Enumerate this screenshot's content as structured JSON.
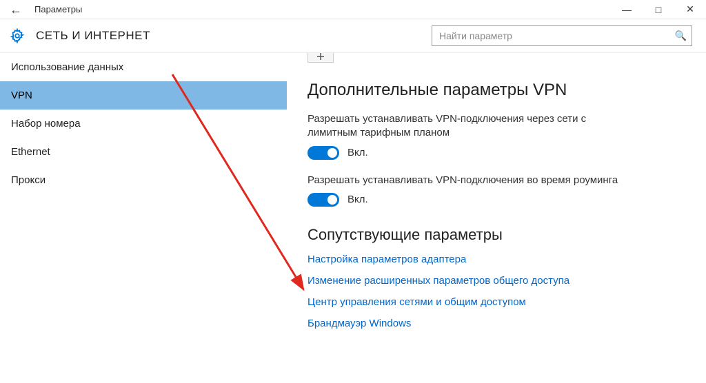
{
  "titlebar": {
    "app_title": "Параметры"
  },
  "header": {
    "section_title": "СЕТЬ И ИНТЕРНЕТ"
  },
  "search": {
    "placeholder": "Найти параметр"
  },
  "sidebar": {
    "items": [
      {
        "label": "Использование данных",
        "selected": false
      },
      {
        "label": "VPN",
        "selected": true
      },
      {
        "label": "Набор номера",
        "selected": false
      },
      {
        "label": "Ethernet",
        "selected": false
      },
      {
        "label": "Прокси",
        "selected": false
      }
    ]
  },
  "main": {
    "heading1": "Дополнительные параметры VPN",
    "setting1": {
      "desc": "Разрешать устанавливать VPN-подключения через сети с лимитным тарифным планом",
      "state": "Вкл."
    },
    "setting2": {
      "desc": "Разрешать устанавливать VPN-подключения во время роуминга",
      "state": "Вкл."
    },
    "heading2": "Сопутствующие параметры",
    "links": [
      "Настройка параметров адаптера",
      "Изменение расширенных параметров общего доступа",
      "Центр управления сетями и общим доступом",
      "Брандмауэр Windows"
    ]
  }
}
